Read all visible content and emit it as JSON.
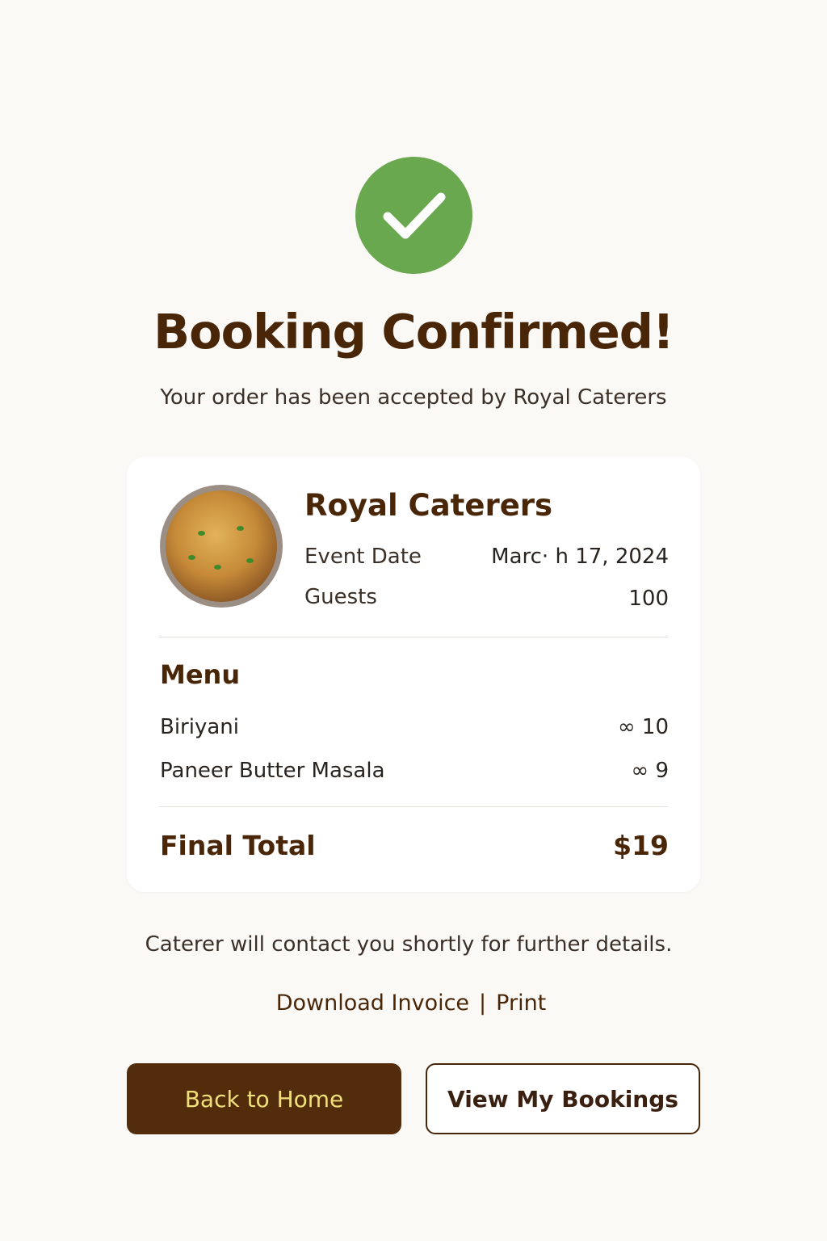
{
  "header": {
    "title": "Booking Confirmed!",
    "subtitle": "Your order has been accepted by Royal Caterers"
  },
  "colors": {
    "success": "#6aa84f",
    "brand": "#532d0b",
    "button_text": "#f0e07a",
    "background": "#fbf9f6"
  },
  "card": {
    "caterer_name": "Royal Caterers",
    "event_date_label": "Event Date",
    "event_date_value": "Marc· h 17, 2024",
    "guests_label": "Guests",
    "guests_value": "100",
    "menu_heading": "Menu",
    "menu_items": [
      {
        "name": "Biriyani",
        "price": "∞ 10"
      },
      {
        "name": "Paneer Butter Masala",
        "price": "∞ 9"
      }
    ],
    "total_label": "Final Total",
    "total_value": "$19"
  },
  "footer": {
    "contact_note": "Caterer will contact you shortly for further details.",
    "download_label": "Download Invoice",
    "separator": "|",
    "print_label": "Print"
  },
  "actions": {
    "home_label": "Back to Home",
    "bookings_label": "View My Bookings"
  }
}
